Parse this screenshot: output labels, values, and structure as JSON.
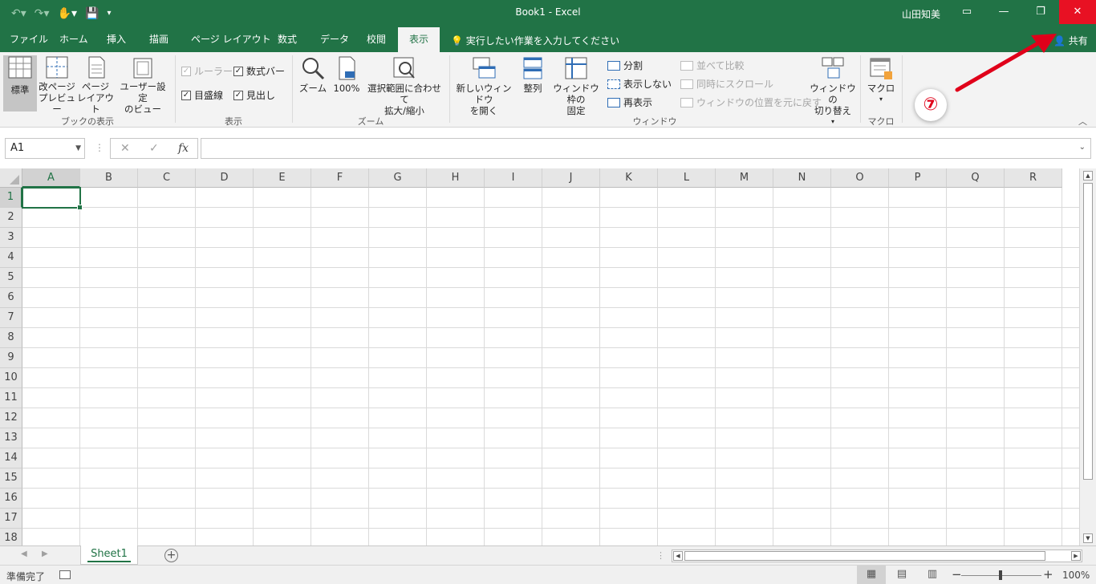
{
  "window": {
    "title": "Book1  -  Excel",
    "user": "山田知美"
  },
  "tabs": [
    "ファイル",
    "ホーム",
    "挿入",
    "描画",
    "ページ レイアウト",
    "数式",
    "データ",
    "校閲",
    "表示"
  ],
  "active_tab": "表示",
  "tell_me": "実行したい作業を入力してください",
  "share": "共有",
  "ribbon": {
    "workbook_views": {
      "label": "ブックの表示",
      "normal": "標準",
      "page_break": [
        "改ページ",
        "プレビュー"
      ],
      "page_layout": [
        "ページ",
        "レイアウト"
      ],
      "custom": [
        "ユーザー設定",
        "のビュー"
      ]
    },
    "show": {
      "label": "表示",
      "ruler": "ルーラー",
      "formula_bar": "数式バー",
      "gridlines": "目盛線",
      "headings": "見出し"
    },
    "zoom": {
      "label": "ズーム",
      "zoom": "ズーム",
      "hundred": "100%",
      "to_selection": [
        "選択範囲に合わせて",
        "拡大/縮小"
      ]
    },
    "window": {
      "label": "ウィンドウ",
      "new_window": [
        "新しいウィンドウ",
        "を開く"
      ],
      "arrange": "整列",
      "freeze": [
        "ウィンドウ枠の",
        "固定"
      ],
      "split": "分割",
      "hide": "表示しない",
      "unhide": "再表示",
      "side_by_side": "並べて比較",
      "sync_scroll": "同時にスクロール",
      "reset_position": "ウィンドウの位置を元に戻す",
      "switch": [
        "ウィンドウの",
        "切り替え"
      ]
    },
    "macros": {
      "label": "マクロ",
      "macros": "マクロ"
    }
  },
  "formula_bar": {
    "name_box": "A1",
    "fx": "fx",
    "value": ""
  },
  "columns": [
    "A",
    "B",
    "C",
    "D",
    "E",
    "F",
    "G",
    "H",
    "I",
    "J",
    "K",
    "L",
    "M",
    "N",
    "O",
    "P",
    "Q",
    "R"
  ],
  "rows": [
    "1",
    "2",
    "3",
    "4",
    "5",
    "6",
    "7",
    "8",
    "9",
    "10",
    "11",
    "12",
    "13",
    "14",
    "15",
    "16",
    "17",
    "18"
  ],
  "active_cell": "A1",
  "sheets": [
    "Sheet1"
  ],
  "status": {
    "ready": "準備完了",
    "zoom": "100%"
  },
  "annotation": {
    "number": "⑦",
    "color": "#e0001a"
  },
  "colors": {
    "excel_green": "#217346",
    "close_red": "#e81123"
  }
}
